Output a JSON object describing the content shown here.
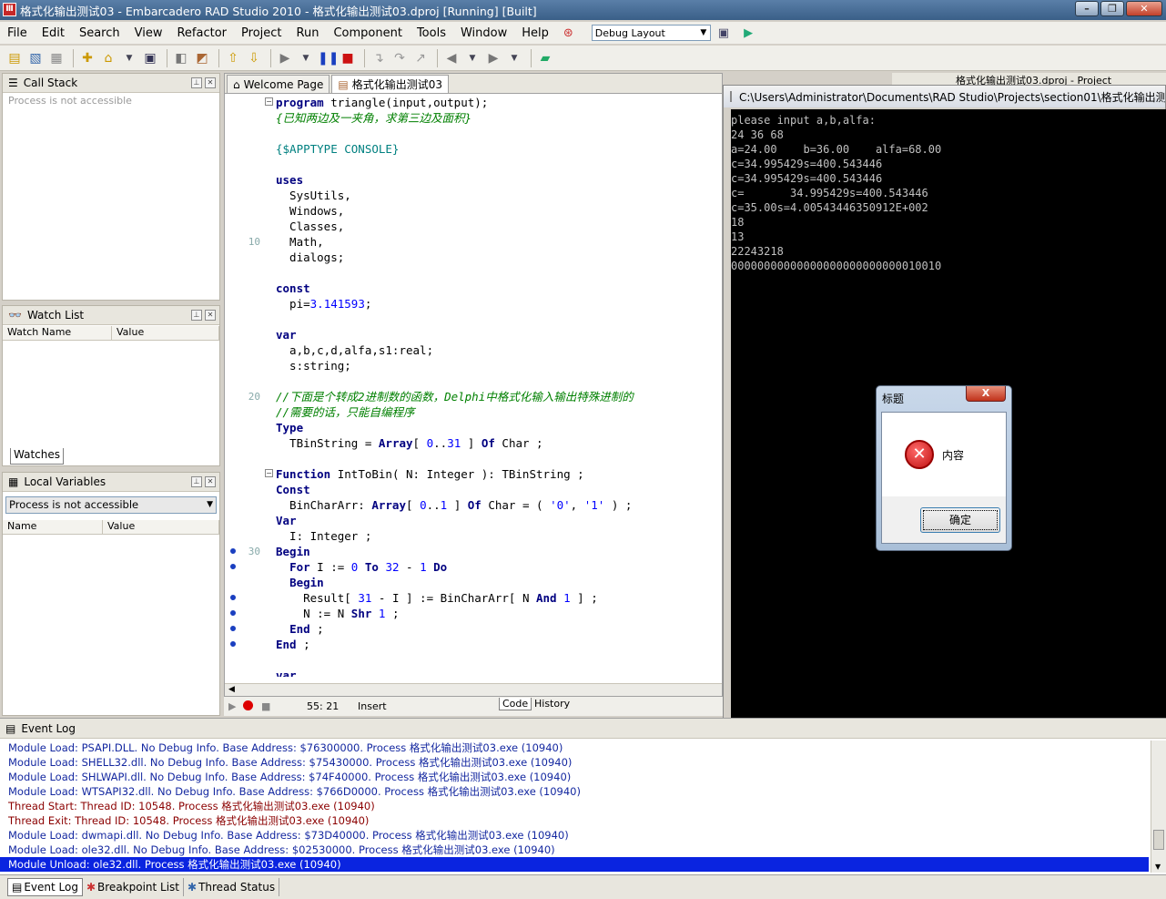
{
  "window": {
    "title": "格式化输出测试03 - Embarcadero RAD Studio 2010 - 格式化输出测试03.dproj [Running] [Built]",
    "app_icon": "rad-studio-icon"
  },
  "menu": [
    "File",
    "Edit",
    "Search",
    "View",
    "Refactor",
    "Project",
    "Run",
    "Component",
    "Tools",
    "Window",
    "Help"
  ],
  "layout_dropdown": "Debug Layout",
  "call_stack": {
    "title": "Call Stack",
    "status": "Process is not accessible"
  },
  "watch_list": {
    "title": "Watch List",
    "columns": [
      "Watch Name",
      "Value"
    ],
    "tab": "Watches"
  },
  "local_vars": {
    "title": "Local Variables",
    "select_value": "Process is not accessible",
    "columns": [
      "Name",
      "Value"
    ]
  },
  "editor": {
    "tabs": [
      "Welcome Page",
      "格式化输出测试03"
    ],
    "gutter_numbers": [
      "10",
      "20",
      "30"
    ],
    "lines": [
      {
        "segs": [
          {
            "t": "program",
            "c": "kw"
          },
          {
            "t": " triangle(input,output);"
          }
        ]
      },
      {
        "segs": [
          {
            "t": "{已知两边及一夹角，求第三边及面积}",
            "c": "cm"
          }
        ]
      },
      {
        "segs": []
      },
      {
        "segs": [
          {
            "t": "{$APPTYPE CONSOLE}",
            "c": "dir"
          }
        ]
      },
      {
        "segs": []
      },
      {
        "segs": [
          {
            "t": "uses",
            "c": "kw"
          }
        ]
      },
      {
        "segs": [
          {
            "t": "  SysUtils,"
          }
        ]
      },
      {
        "segs": [
          {
            "t": "  Windows,"
          }
        ]
      },
      {
        "segs": [
          {
            "t": "  Classes,"
          }
        ]
      },
      {
        "segs": [
          {
            "t": "  Math,"
          }
        ]
      },
      {
        "segs": [
          {
            "t": "  dialogs;"
          }
        ]
      },
      {
        "segs": []
      },
      {
        "segs": [
          {
            "t": "const",
            "c": "kw"
          }
        ]
      },
      {
        "segs": [
          {
            "t": "  pi="
          },
          {
            "t": "3.141593",
            "c": "num"
          },
          {
            "t": ";"
          }
        ]
      },
      {
        "segs": []
      },
      {
        "segs": [
          {
            "t": "var",
            "c": "kw"
          }
        ]
      },
      {
        "segs": [
          {
            "t": "  a,b,c,d,alfa,s1:real;"
          }
        ]
      },
      {
        "segs": [
          {
            "t": "  s:string;"
          }
        ]
      },
      {
        "segs": []
      },
      {
        "segs": [
          {
            "t": "//下面是个转成2进制数的函数，Delphi中格式化输入输出特殊进制的",
            "c": "cm"
          }
        ]
      },
      {
        "segs": [
          {
            "t": "//需要的话，只能自编程序",
            "c": "cm"
          }
        ]
      },
      {
        "segs": [
          {
            "t": "Type",
            "c": "kw"
          }
        ]
      },
      {
        "segs": [
          {
            "t": "  TBinString = "
          },
          {
            "t": "Array",
            "c": "kw"
          },
          {
            "t": "[ "
          },
          {
            "t": "0",
            "c": "num"
          },
          {
            "t": ".."
          },
          {
            "t": "31",
            "c": "num"
          },
          {
            "t": " ] "
          },
          {
            "t": "Of",
            "c": "kw"
          },
          {
            "t": " Char ;"
          }
        ]
      },
      {
        "segs": []
      },
      {
        "segs": [
          {
            "t": "Function",
            "c": "kw"
          },
          {
            "t": " IntToBin( N: Integer ): TBinString ;"
          }
        ]
      },
      {
        "segs": [
          {
            "t": "Const",
            "c": "kw"
          }
        ]
      },
      {
        "segs": [
          {
            "t": "  BinCharArr: "
          },
          {
            "t": "Array",
            "c": "kw"
          },
          {
            "t": "[ "
          },
          {
            "t": "0",
            "c": "num"
          },
          {
            "t": ".."
          },
          {
            "t": "1",
            "c": "num"
          },
          {
            "t": " ] "
          },
          {
            "t": "Of",
            "c": "kw"
          },
          {
            "t": " Char = ( "
          },
          {
            "t": "'0'",
            "c": "str"
          },
          {
            "t": ", "
          },
          {
            "t": "'1'",
            "c": "str"
          },
          {
            "t": " ) ;"
          }
        ]
      },
      {
        "segs": [
          {
            "t": "Var",
            "c": "kw"
          }
        ]
      },
      {
        "segs": [
          {
            "t": "  I: Integer ;"
          }
        ]
      },
      {
        "segs": [
          {
            "t": "Begin",
            "c": "kw"
          }
        ]
      },
      {
        "segs": [
          {
            "t": "  "
          },
          {
            "t": "For",
            "c": "kw"
          },
          {
            "t": " I := "
          },
          {
            "t": "0",
            "c": "num"
          },
          {
            "t": " "
          },
          {
            "t": "To",
            "c": "kw"
          },
          {
            "t": " "
          },
          {
            "t": "32",
            "c": "num"
          },
          {
            "t": " - "
          },
          {
            "t": "1",
            "c": "num"
          },
          {
            "t": " "
          },
          {
            "t": "Do",
            "c": "kw"
          }
        ]
      },
      {
        "segs": [
          {
            "t": "  "
          },
          {
            "t": "Begin",
            "c": "kw"
          }
        ]
      },
      {
        "segs": [
          {
            "t": "    Result[ "
          },
          {
            "t": "31",
            "c": "num"
          },
          {
            "t": " - I ] := BinCharArr[ N "
          },
          {
            "t": "And",
            "c": "kw"
          },
          {
            "t": " "
          },
          {
            "t": "1",
            "c": "num"
          },
          {
            "t": " ] ;"
          }
        ]
      },
      {
        "segs": [
          {
            "t": "    N := N "
          },
          {
            "t": "Shr",
            "c": "kw"
          },
          {
            "t": " "
          },
          {
            "t": "1",
            "c": "num"
          },
          {
            "t": " ;"
          }
        ]
      },
      {
        "segs": [
          {
            "t": "  "
          },
          {
            "t": "End",
            "c": "kw"
          },
          {
            "t": " ;"
          }
        ]
      },
      {
        "segs": [
          {
            "t": "End",
            "c": "kw"
          },
          {
            "t": " ;"
          }
        ]
      },
      {
        "segs": []
      },
      {
        "segs": [
          {
            "t": "var",
            "c": "kw"
          }
        ]
      }
    ]
  },
  "editor_status": {
    "position": "55: 21",
    "mode": "Insert",
    "tabs": [
      "Code",
      "History"
    ]
  },
  "console": {
    "title": "C:\\Users\\Administrator\\Documents\\RAD Studio\\Projects\\section01\\格式化输出测",
    "lines": [
      "please input a,b,alfa:",
      "24 36 68",
      "a=24.00    b=36.00    alfa=68.00",
      "c=34.995429s=400.543446",
      "c=34.995429s=400.543446",
      "c=       34.995429s=400.543446",
      "c=35.00s=4.00543446350912E+002",
      "18",
      "13",
      "22243218",
      "00000000000000000000000000010010"
    ]
  },
  "background_tab": "格式化输出测试03.dproj - Project",
  "msgbox": {
    "title": "标题",
    "text": "内容",
    "ok": "确定",
    "close": "X"
  },
  "event_log": {
    "title": "Event Log",
    "entries": [
      {
        "text": "Module Load: PSAPI.DLL. No Debug Info. Base Address: $76300000. Process 格式化输出测试03.exe (10940)",
        "kind": "mod"
      },
      {
        "text": "Module Load: SHELL32.dll. No Debug Info. Base Address: $75430000. Process 格式化输出测试03.exe (10940)",
        "kind": "mod"
      },
      {
        "text": "Module Load: SHLWAPI.dll. No Debug Info. Base Address: $74F40000. Process 格式化输出测试03.exe (10940)",
        "kind": "mod"
      },
      {
        "text": "Module Load: WTSAPI32.dll. No Debug Info. Base Address: $766D0000. Process 格式化输出测试03.exe (10940)",
        "kind": "mod"
      },
      {
        "text": "Thread Start: Thread ID: 10548. Process 格式化输出测试03.exe (10940)",
        "kind": "thr"
      },
      {
        "text": "Thread Exit: Thread ID: 10548. Process 格式化输出测试03.exe (10940)",
        "kind": "thr"
      },
      {
        "text": "Module Load: dwmapi.dll. No Debug Info. Base Address: $73D40000. Process 格式化输出测试03.exe (10940)",
        "kind": "mod"
      },
      {
        "text": "Module Load: ole32.dll. No Debug Info. Base Address: $02530000. Process 格式化输出测试03.exe (10940)",
        "kind": "mod"
      },
      {
        "text": "Module Unload: ole32.dll. Process 格式化输出测试03.exe (10940)",
        "kind": "sel"
      }
    ]
  },
  "bottom_tabs": [
    "Event Log",
    "Breakpoint List",
    "Thread Status"
  ]
}
